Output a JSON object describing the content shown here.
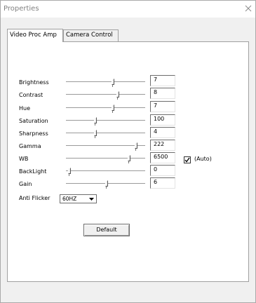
{
  "window": {
    "title": "Properties"
  },
  "tabs": [
    {
      "label": "Video Proc Amp",
      "active": true
    },
    {
      "label": "Camera Control",
      "active": false
    }
  ],
  "controls": [
    {
      "label": "Brightness",
      "value": "7"
    },
    {
      "label": "Contrast",
      "value": "8"
    },
    {
      "label": "Hue",
      "value": "7"
    },
    {
      "label": "Saturation",
      "value": "100"
    },
    {
      "label": "Sharpness",
      "value": "4"
    },
    {
      "label": "Gamma",
      "value": "222"
    },
    {
      "label": "WB",
      "value": "6500"
    },
    {
      "label": "BackLight",
      "value": "0"
    },
    {
      "label": "Gain",
      "value": "6"
    }
  ],
  "wb_auto": {
    "label": "(Auto)",
    "checked": true
  },
  "anti_flicker": {
    "label": "Anti Flicker",
    "selected": "60HZ"
  },
  "buttons": {
    "default_label": "Default"
  },
  "icons": {
    "close": "close-icon",
    "dropdown": "chevron-down-icon",
    "check": "checkmark-icon"
  },
  "colors": {
    "panel_bg": "#ffffff",
    "window_bg": "#f0f0f0",
    "border": "#a0a0a0"
  }
}
